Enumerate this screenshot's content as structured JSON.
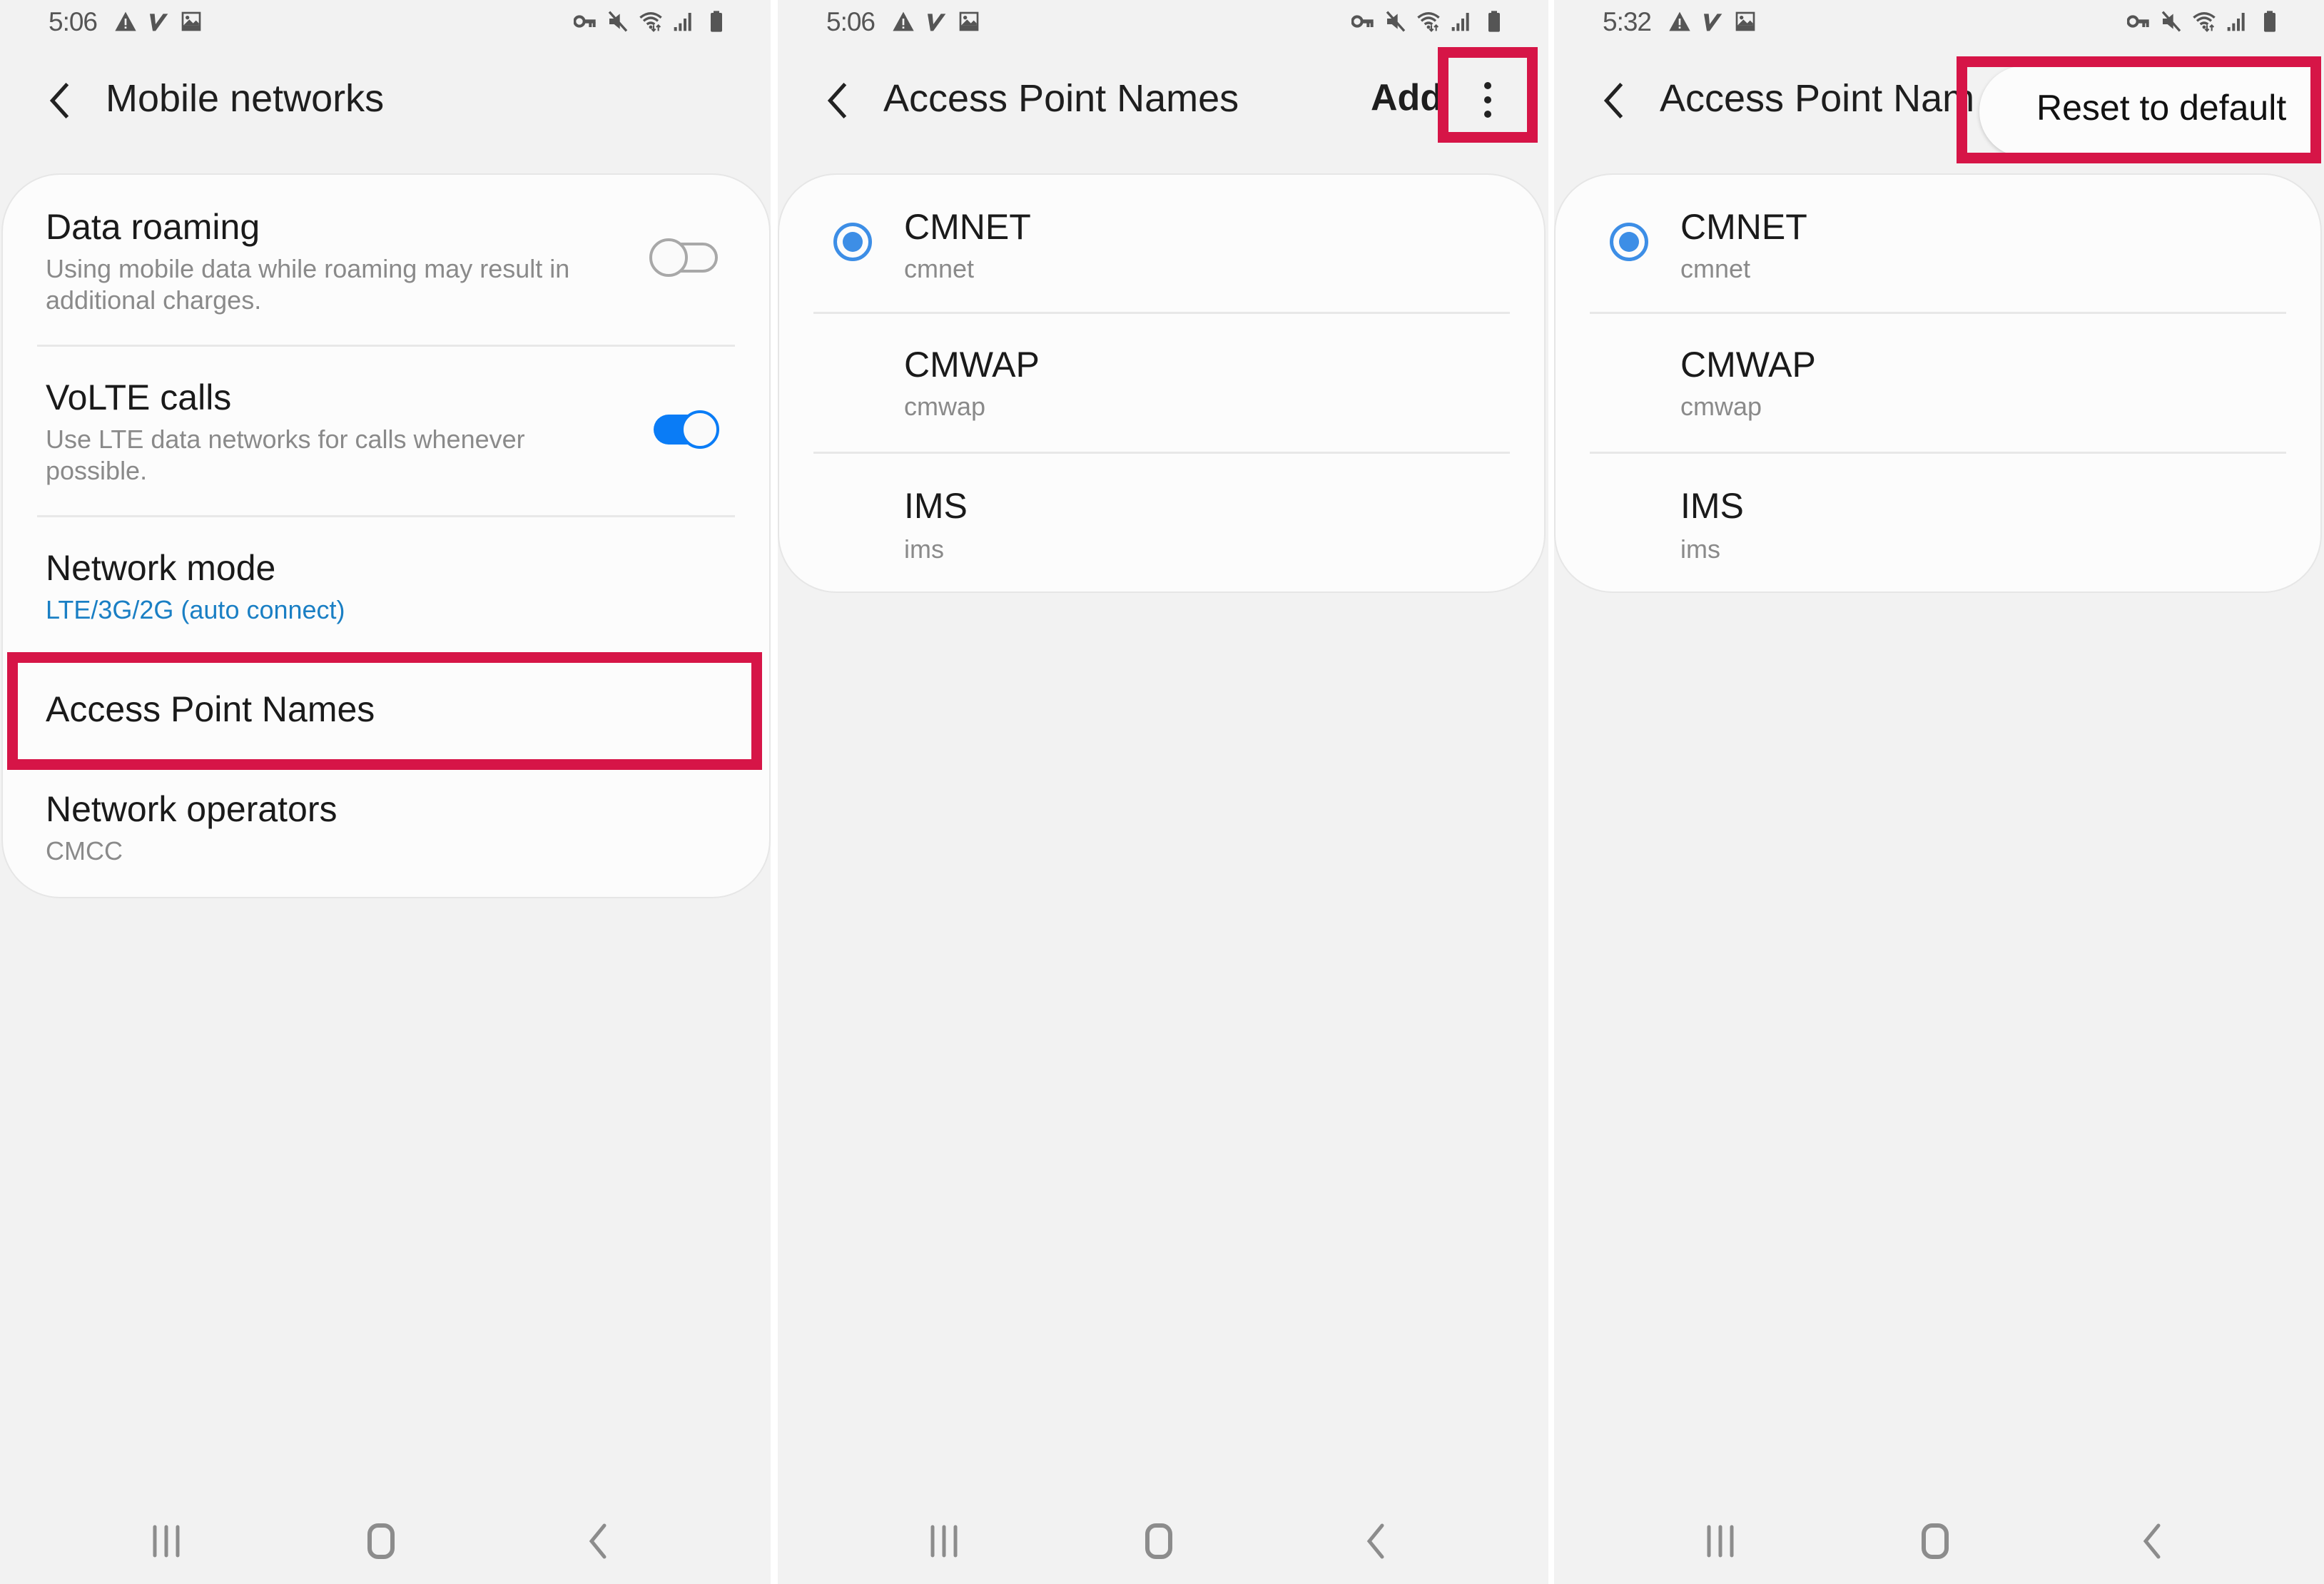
{
  "panels": [
    {
      "status_bar": {
        "time": "5:06",
        "left_icons": [
          "alert-icon",
          "v-app-icon",
          "image-icon"
        ],
        "right_icons": [
          "vpn-key-icon",
          "mute-icon",
          "wifi-icon",
          "signal-icon",
          "battery-icon"
        ]
      },
      "header": {
        "title": "Mobile networks",
        "back_icon": "chevron-left-icon"
      },
      "settings": [
        {
          "title": "Data roaming",
          "subtitle": "Using mobile data while roaming may result in additional charges.",
          "toggle": false
        },
        {
          "title": "VoLTE calls",
          "subtitle": "Use LTE data networks for calls whenever possible.",
          "toggle": true
        },
        {
          "title": "Network mode",
          "subtitle": "LTE/3G/2G (auto connect)"
        },
        {
          "title": "Access Point Names",
          "highlighted": true
        },
        {
          "title": "Network operators",
          "subtitle": "CMCC"
        }
      ],
      "nav_bar": [
        "recents-icon",
        "home-icon",
        "back-icon"
      ]
    },
    {
      "status_bar": {
        "time": "5:06",
        "left_icons": [
          "alert-icon",
          "v-app-icon",
          "image-icon"
        ],
        "right_icons": [
          "vpn-key-icon",
          "mute-icon",
          "wifi-icon",
          "signal-icon",
          "battery-icon"
        ]
      },
      "header": {
        "title": "Access Point Names",
        "add_label": "Add",
        "more_icon": "more-vert-icon",
        "more_highlighted": true
      },
      "apns": [
        {
          "name": "CMNET",
          "apn": "cmnet",
          "selected": true
        },
        {
          "name": "CMWAP",
          "apn": "cmwap",
          "selected": false
        },
        {
          "name": "IMS",
          "apn": "ims",
          "selected": false
        }
      ],
      "nav_bar": [
        "recents-icon",
        "home-icon",
        "back-icon"
      ]
    },
    {
      "status_bar": {
        "time": "5:32",
        "left_icons": [
          "alert-icon",
          "v-app-icon",
          "image-icon"
        ],
        "right_icons": [
          "vpn-key-icon",
          "mute-icon",
          "wifi-icon",
          "signal-icon",
          "battery-icon"
        ]
      },
      "header": {
        "title": "Access Point Nam"
      },
      "menu": {
        "items": [
          "Reset to default"
        ],
        "highlighted": true
      },
      "apns": [
        {
          "name": "CMNET",
          "apn": "cmnet",
          "selected": true
        },
        {
          "name": "CMWAP",
          "apn": "cmwap",
          "selected": false
        },
        {
          "name": "IMS",
          "apn": "ims",
          "selected": false
        }
      ],
      "nav_bar": [
        "recents-icon",
        "home-icon",
        "back-icon"
      ]
    }
  ],
  "colors": {
    "background": "#f2f2f2",
    "card": "#fcfcfc",
    "accent_blue": "#0a7cf6",
    "link_blue": "#1a7fc4",
    "highlight_red": "#d61547",
    "secondary_text": "#8a8a8a"
  }
}
